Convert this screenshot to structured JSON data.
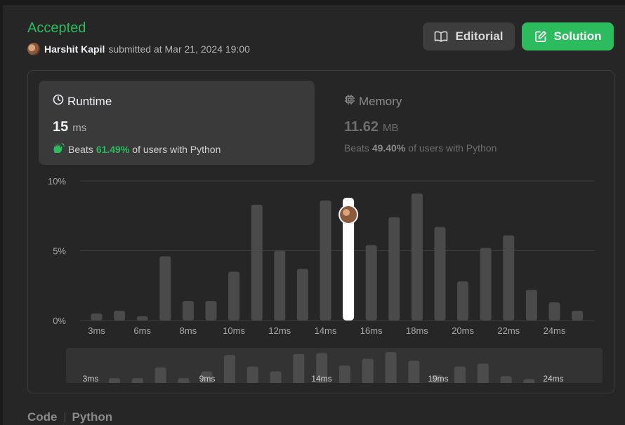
{
  "header": {
    "status": "Accepted",
    "username": "Harshit Kapil",
    "submitted_text": "submitted at Mar 21, 2024 19:00",
    "editorial_label": "Editorial",
    "solution_label": "Solution"
  },
  "runtime": {
    "title": "Runtime",
    "value": "15",
    "unit": "ms",
    "beats_prefix": "Beats",
    "beats_pct": "61.49%",
    "beats_suffix": "of users with Python"
  },
  "memory": {
    "title": "Memory",
    "value": "11.62",
    "unit": "MB",
    "beats_prefix": "Beats",
    "beats_pct": "49.40%",
    "beats_suffix": "of users with Python"
  },
  "code_section": {
    "label": "Code",
    "language": "Python"
  },
  "colors": {
    "accent_green": "#2cbb5d",
    "bar": "#4a4a4a",
    "highlight_bar": "#ffffff"
  },
  "icons": {
    "runtime": "clock-icon",
    "memory": "chip-icon",
    "editorial": "book-icon",
    "solution": "edit-icon",
    "beats": "clap-icon"
  },
  "chart_data": {
    "type": "bar",
    "y_tick_labels": [
      "10%",
      "5%",
      "0%"
    ],
    "ylim": [
      0,
      10
    ],
    "x_tick_labels": [
      "3ms",
      "6ms",
      "8ms",
      "10ms",
      "12ms",
      "14ms",
      "16ms",
      "18ms",
      "20ms",
      "22ms",
      "24ms"
    ],
    "values": [
      0.5,
      0.7,
      0.3,
      4.6,
      1.4,
      1.4,
      3.5,
      8.3,
      5.0,
      3.7,
      8.6,
      8.7,
      5.4,
      7.4,
      9.1,
      6.7,
      2.8,
      5.2,
      6.1,
      2.2,
      1.3,
      0.7
    ],
    "highlight_index": 11,
    "grid": true
  },
  "overview": {
    "tick_labels": [
      "3ms",
      "9ms",
      "14ms",
      "19ms",
      "24ms"
    ],
    "values": [
      0.5,
      0.5,
      1.6,
      0.5,
      1.2,
      2.9,
      1.7,
      1.2,
      3.0,
      3.1,
      1.8,
      2.5,
      3.2,
      2.3,
      0.8,
      1.7,
      2.0,
      0.7,
      0.4
    ]
  }
}
